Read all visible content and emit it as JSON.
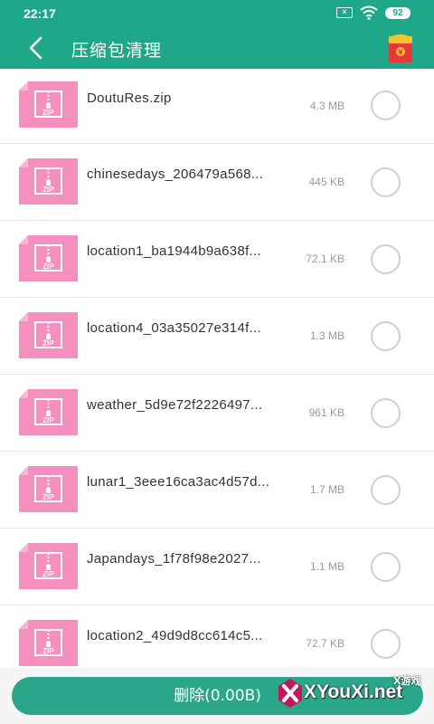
{
  "status_bar": {
    "time": "22:17",
    "battery": "92"
  },
  "app_bar": {
    "title": "压缩包清理"
  },
  "files": [
    {
      "name": "DoutuRes.zip",
      "size": "4.3 MB"
    },
    {
      "name": "chinesedays_206479a568...",
      "size": "445 KB"
    },
    {
      "name": "location1_ba1944b9a638f...",
      "size": "72.1 KB"
    },
    {
      "name": "location4_03a35027e314f...",
      "size": "1.3 MB"
    },
    {
      "name": "weather_5d9e72f2226497...",
      "size": "961 KB"
    },
    {
      "name": "lunar1_3eee16ca3ac4d57d...",
      "size": "1.7 MB"
    },
    {
      "name": "Japandays_1f78f98e2027...",
      "size": "1.1 MB"
    },
    {
      "name": "location2_49d9d8cc614c5...",
      "size": "72.7 KB"
    }
  ],
  "zip_icon_text": "ZIP",
  "bottom": {
    "delete_label": "删除(0.00B)"
  },
  "watermark": {
    "brand": "XYouXi.net",
    "sub": "X游戏"
  },
  "colors": {
    "primary": "#1ea889",
    "button": "#2aa78a",
    "zip_pink": "#f48fc0"
  }
}
